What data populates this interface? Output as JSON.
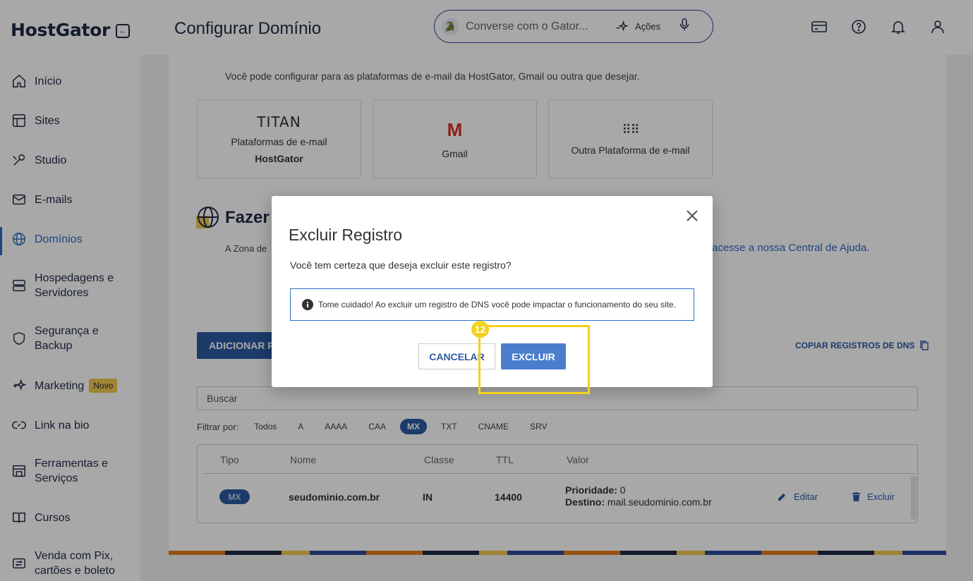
{
  "sidebar": {
    "logo": "HostGator",
    "items": [
      {
        "label": "Início"
      },
      {
        "label": "Sites"
      },
      {
        "label": "Studio"
      },
      {
        "label": "E-mails"
      },
      {
        "label": "Domínios"
      },
      {
        "label": "Hospedagens e Servidores"
      },
      {
        "label": "Segurança e Backup"
      },
      {
        "label": "Marketing",
        "badge": "Novo"
      },
      {
        "label": "Link na bio"
      },
      {
        "label": "Ferramentas e Serviços"
      },
      {
        "label": "Cursos"
      },
      {
        "label": "Venda com Pix, cartões e boleto"
      }
    ]
  },
  "header": {
    "title": "Configurar Domínio",
    "chat_placeholder": "Converse com o Gator...",
    "actions_label": "Ações"
  },
  "email_section": {
    "subtitle": "Você pode configurar para as plataformas de e-mail da HostGator, Gmail ou outra que desejar.",
    "platforms": {
      "titan_logo": "TITAN",
      "titan_line1": "Plataformas de e-mail",
      "titan_line2": "HostGator",
      "gmail_label": "Gmail",
      "other_label": "Outra Plataforma de e-mail"
    }
  },
  "dns_section": {
    "title_partial": "Fazer",
    "text_partial": "A Zona de",
    "help_link": "acesse a nossa Central de Ajuda.",
    "add_button": "ADICIONAR R",
    "copy_button": "COPIAR REGISTROS DE DNS",
    "search_placeholder": "Buscar",
    "filter_label": "Filtrar por:",
    "filters": [
      "Todos",
      "A",
      "AAAA",
      "CAA",
      "MX",
      "TXT",
      "CNAME",
      "SRV"
    ],
    "active_filter": "MX",
    "table": {
      "headers": [
        "Tipo",
        "Nome",
        "Classe",
        "TTL",
        "Valor"
      ],
      "row": {
        "tipo": "MX",
        "nome": "seudominio.com.br",
        "classe": "IN",
        "ttl": "14400",
        "prioridade_label": "Prioridade:",
        "prioridade": "0",
        "destino_label": "Destino:",
        "destino": "mail.seudominio.com.br",
        "edit": "Editar",
        "delete": "Excluir"
      }
    }
  },
  "modal": {
    "title": "Excluir Registro",
    "question": "Você tem certeza que deseja excluir este registro?",
    "warning": "Tome cuidado! Ao excluir um registro de DNS você pode impactar o funcionamento do seu site.",
    "cancel": "CANCELAR",
    "confirm": "EXCLUIR"
  },
  "annotation": {
    "step": "12"
  },
  "colors": {
    "primary": "#2b5aa3",
    "link": "#2b6cc4",
    "highlight": "#f2d21c",
    "badge": "#f2c94c"
  }
}
